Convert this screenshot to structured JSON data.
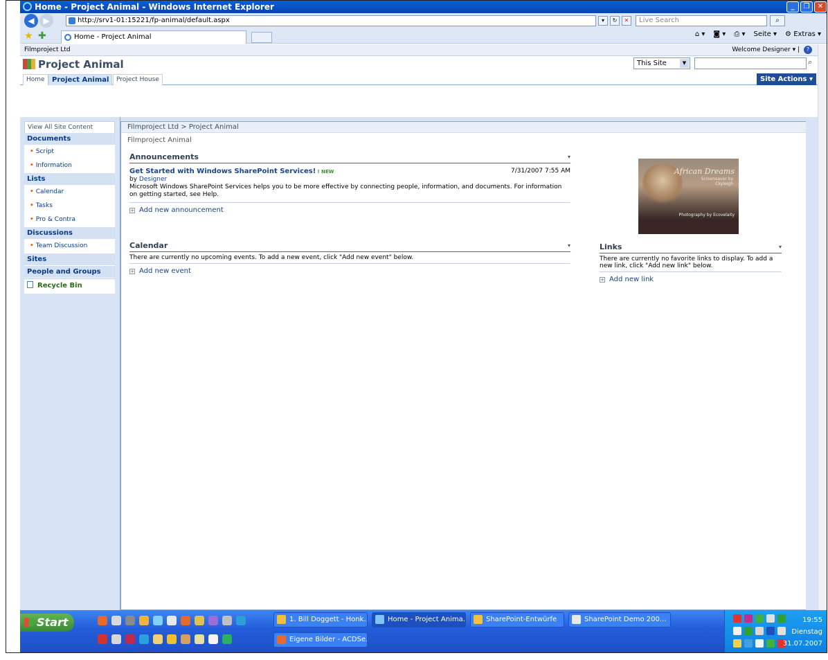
{
  "browser": {
    "window_title": "Home - Project Animal - Windows Internet Explorer",
    "url": "http://srv1-01:15221/fp-animal/default.aspx",
    "search_placeholder": "Live Search",
    "tab_label": "Home - Project Animal",
    "cmd_seite": "Seite",
    "cmd_extras": "Extras"
  },
  "sharepoint": {
    "global_crumb": "Filmproject Ltd",
    "welcome": "Welcome Designer",
    "site_title": "Project Animal",
    "search_scope": "This Site",
    "site_actions": "Site Actions",
    "tabs": [
      {
        "label": "Home"
      },
      {
        "label": "Project Animal"
      },
      {
        "label": "Project House"
      }
    ],
    "quick_launch": {
      "view_all": "View All Site Content",
      "documents_head": "Documents",
      "documents": [
        "Script",
        "Information"
      ],
      "lists_head": "Lists",
      "lists": [
        "Calendar",
        "Tasks",
        "Pro & Contra"
      ],
      "discussions_head": "Discussions",
      "discussions": [
        "Team Discussion"
      ],
      "sites_head": "Sites",
      "people_head": "People and Groups",
      "recycle": "Recycle Bin"
    },
    "breadcrumb": "Filmproject Ltd > Project Animal",
    "page_title": "Filmproject Animal",
    "announcements": {
      "title": "Announcements",
      "item_title": "Get Started with Windows SharePoint Services!",
      "new_badge": "NEW",
      "date": "7/31/2007 7:55 AM",
      "by_prefix": "by",
      "author": "Designer",
      "body": "Microsoft Windows SharePoint Services helps you to be more effective by connecting people, information, and documents. For information on getting started, see Help.",
      "add": "Add new announcement"
    },
    "calendar": {
      "title": "Calendar",
      "empty": "There are currently no upcoming events. To add a new event, click \"Add new event\" below.",
      "add": "Add new event"
    },
    "image": {
      "line1": "African Dreams",
      "line2": "Screensaver by",
      "line3": "Ckyleigh",
      "line4": "Photography by Ecovelaity"
    },
    "links": {
      "title": "Links",
      "empty": "There are currently no favorite links to display. To add a new link, click \"Add new link\" below.",
      "add": "Add new link"
    }
  },
  "taskbar": {
    "start": "Start",
    "tasks": [
      {
        "label": "1. Bill Doggett - Honk..."
      },
      {
        "label": "Home - Project Anima..."
      },
      {
        "label": "SharePoint-Entwürfe"
      },
      {
        "label": "SharePoint Demo 200..."
      },
      {
        "label": "Eigene Bilder - ACDSe..."
      }
    ],
    "time": "19:55",
    "day": "Dienstag",
    "date": "31.07.2007"
  }
}
